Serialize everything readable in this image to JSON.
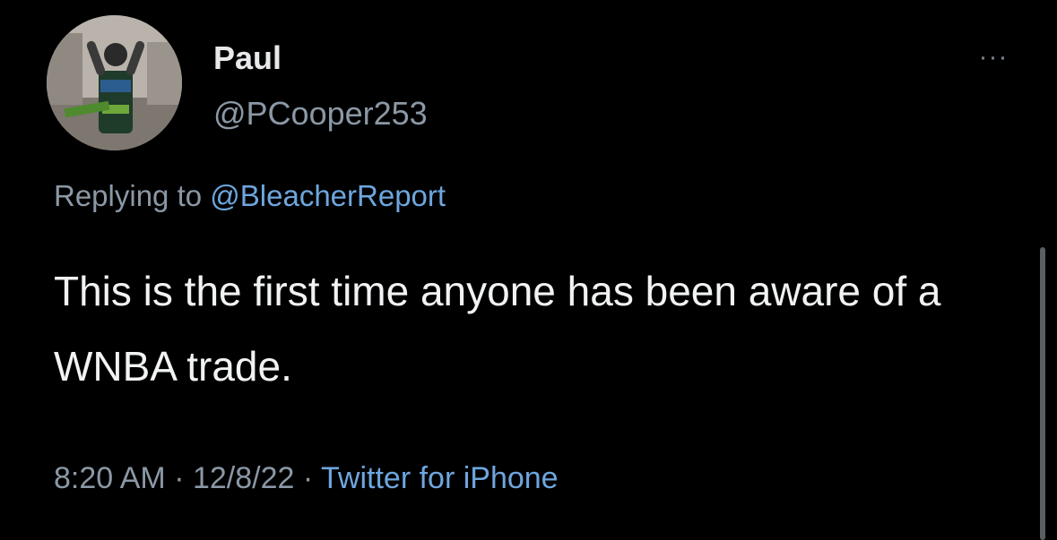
{
  "author": {
    "name": "Paul",
    "handle": "@PCooper253",
    "avatar_icon": "user-avatar-photo"
  },
  "menu": {
    "more_label": "···",
    "icon": "more-horizontal-icon"
  },
  "reply": {
    "prefix": "Replying to ",
    "handle": "@BleacherReport"
  },
  "tweet": {
    "text": "This is the first time anyone has been aware of a WNBA trade."
  },
  "meta": {
    "time": "8:20 AM",
    "separator": " · ",
    "date": "12/8/22",
    "source": "Twitter for iPhone"
  },
  "colors": {
    "background": "#000000",
    "text_primary": "#e7e9ea",
    "text_secondary": "#8b98a5",
    "link": "#6ea6dd"
  }
}
